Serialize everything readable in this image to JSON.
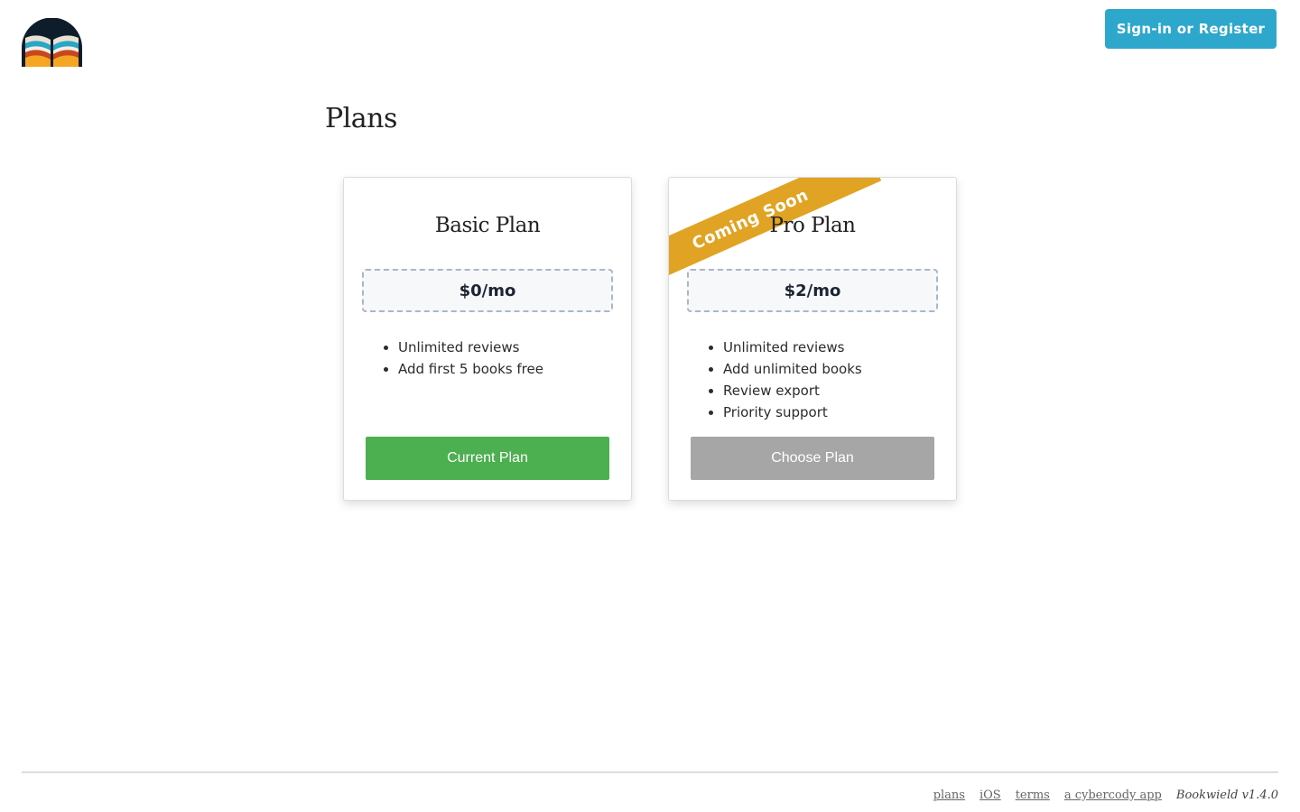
{
  "header": {
    "signin_label": "Sign-in or Register"
  },
  "page": {
    "title": "Plans"
  },
  "plans": [
    {
      "name": "Basic Plan",
      "price": "$0/mo",
      "features": [
        "Unlimited reviews",
        "Add first 5 books free"
      ],
      "button_label": "Current Plan"
    },
    {
      "name": "Pro Plan",
      "price": "$2/mo",
      "ribbon": "Coming Soon",
      "features": [
        "Unlimited reviews",
        "Add unlimited books",
        "Review export",
        "Priority support"
      ],
      "button_label": "Choose Plan"
    }
  ],
  "footer": {
    "links": [
      "plans",
      "iOS",
      "terms",
      "a cybercody app"
    ],
    "version": "Bookwield v1.4.0"
  },
  "colors": {
    "primary": "#2ea7cc",
    "success": "#4caf50",
    "disabled": "#a6a6a6",
    "ribbon": "#e0a323"
  }
}
